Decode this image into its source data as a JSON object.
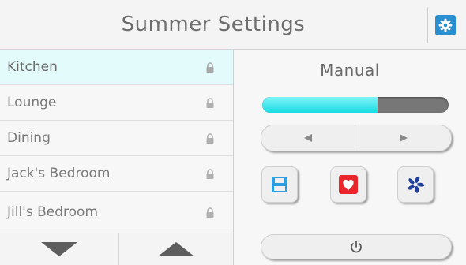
{
  "header": {
    "title": "Summer Settings",
    "settings_icon": "gear-icon"
  },
  "rooms": [
    {
      "label": "Kitchen",
      "selected": true,
      "icon": "lock-icon"
    },
    {
      "label": "Lounge",
      "selected": false,
      "icon": "lock-icon"
    },
    {
      "label": "Dining",
      "selected": false,
      "icon": "lock-icon"
    },
    {
      "label": "Jack's Bedroom",
      "selected": false,
      "icon": "lock-icon"
    },
    {
      "label": "Jill's Bedroom",
      "selected": false,
      "icon": "lock-icon"
    }
  ],
  "scroll": {
    "down_icon": "triangle-down-icon",
    "up_icon": "triangle-up-icon"
  },
  "control": {
    "mode_label": "Manual",
    "level_fraction": 0.62,
    "prev_icon": "triangle-left-icon",
    "next_icon": "triangle-right-icon",
    "save_icon": "floppy-disk-icon",
    "favorite_icon": "heart-icon",
    "fan_icon": "fan-icon",
    "power_icon": "power-icon"
  },
  "colors": {
    "accent": "#2a8fd0",
    "level_fill": "#19dbe6",
    "favorite": "#e8262b",
    "fan": "#1e3f9c",
    "save": "#2b9fe0"
  }
}
